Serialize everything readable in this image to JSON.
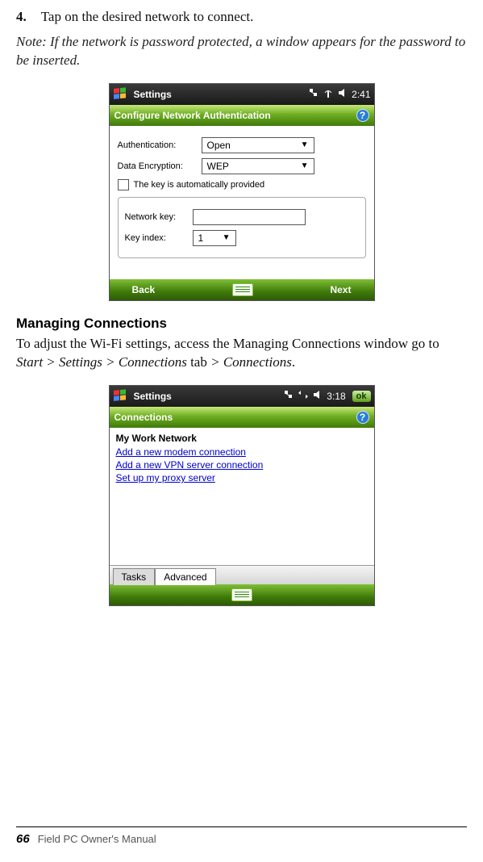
{
  "step": {
    "num": "4.",
    "text": "Tap on the desired network to connect."
  },
  "note": "Note: If the network is password protected, a window appears for the password to be inserted.",
  "shot1": {
    "title": "Settings",
    "time": "2:41",
    "header": "Configure Network Authentication",
    "fields": {
      "auth_label": "Authentication:",
      "auth_value": "Open",
      "enc_label": "Data Encryption:",
      "enc_value": "WEP",
      "auto_key": "The key is automatically provided",
      "netkey_label": "Network key:",
      "keyidx_label": "Key index:",
      "keyidx_value": "1"
    },
    "soft_left": "Back",
    "soft_right": "Next"
  },
  "section": {
    "heading": "Managing Connections",
    "body_plain1": "To adjust the Wi-Fi settings, access the Managing Connections window go to ",
    "body_ital1": "Start > Settings > Connections",
    "body_plain2": " tab ",
    "body_ital2": "> Connections",
    "body_plain3": "."
  },
  "shot2": {
    "title": "Settings",
    "time": "3:18",
    "ok": "ok",
    "header": "Connections",
    "group": "My Work Network",
    "links": [
      "Add a new modem connection",
      "Add a new VPN server connection",
      "Set up my proxy server"
    ],
    "tabs": {
      "tasks": "Tasks",
      "advanced": "Advanced"
    }
  },
  "footer": {
    "page": "66",
    "label": "Field PC Owner's Manual"
  }
}
